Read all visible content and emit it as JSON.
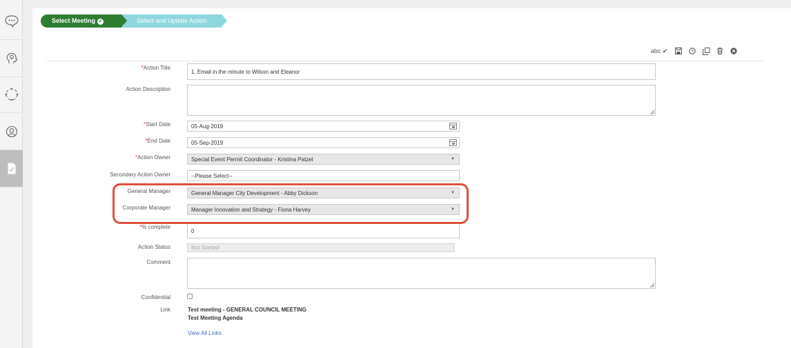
{
  "steps": {
    "step1": "Select Meeting",
    "step2": "Select and Update Action"
  },
  "toolbar": {
    "spell_label": "abc",
    "spell_check": "✔"
  },
  "form": {
    "action_title": {
      "label": "Action Title",
      "value": "1. Email in the minute to Wilson and Eleanor"
    },
    "action_description": {
      "label": "Action Description",
      "value": ""
    },
    "start_date": {
      "label": "Start Date",
      "value": "05-Aug-2019"
    },
    "end_date": {
      "label": "End Date",
      "value": "05-Sep-2019"
    },
    "action_owner": {
      "label": "Action Owner",
      "value": "Special Event Permit Coordinator - Kristina Patzel"
    },
    "secondary_owner": {
      "label": "Secondary Action Owner",
      "value": "--Please Select--"
    },
    "general_manager": {
      "label": "General Manager",
      "value": "General Manager City Development - Abby Dickson"
    },
    "corporate_manager": {
      "label": "Corporate Manager",
      "value": "Manager Innovation and Strategy - Fiona Harvey"
    },
    "percent_complete": {
      "label": "% complete",
      "value": "0"
    },
    "action_status": {
      "label": "Action Status",
      "value": "Not Started"
    },
    "comment": {
      "label": "Comment",
      "value": ""
    },
    "confidential": {
      "label": "Confidential",
      "checked": false
    },
    "link": {
      "label": "Link",
      "items": [
        "Test meeting - GENERAL COUNCIL MEETING",
        "Test Meeting Agenda"
      ],
      "view_all": "View All Links"
    }
  },
  "required_marker": "*",
  "colors": {
    "step_active": "#2e7d32",
    "step_next": "#8fd7de",
    "required": "#e2413a",
    "highlight": "#e0503a",
    "link": "#3d6dbb"
  }
}
